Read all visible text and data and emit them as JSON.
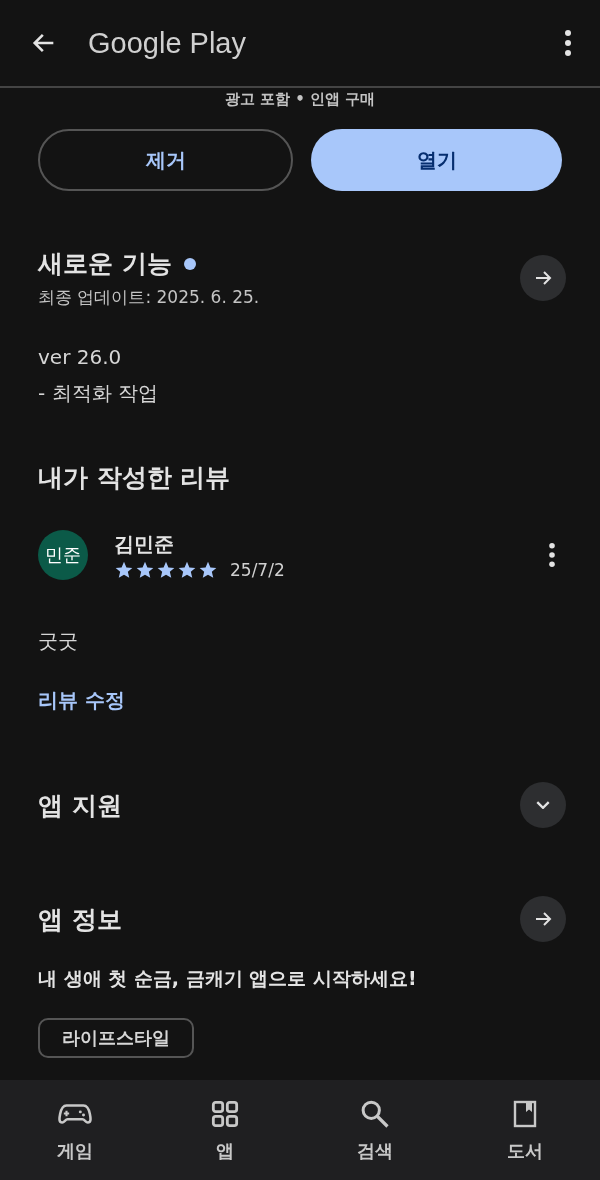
{
  "header": {
    "title": "Google Play"
  },
  "subtitle": "광고 포함 • 인앱 구매",
  "buttons": [
    {
      "label": "제거",
      "kind": "outline"
    },
    {
      "label": "열기",
      "kind": "filled"
    }
  ],
  "whats_new": {
    "title": "새로운 기능",
    "updated": "최종 업데이트: 2025. 6. 25.",
    "lines": [
      "ver 26.0",
      "- 최적화 작업"
    ]
  },
  "my_review": {
    "title": "내가 작성한 리뷰",
    "avatar": "민준",
    "name": "김민준",
    "stars": 5,
    "date": "25/7/2",
    "text": "굿굿",
    "edit_link": "리뷰 수정"
  },
  "sections": [
    {
      "title": "앱 지원",
      "kind": "expand"
    },
    {
      "title": "앱 정보",
      "kind": "arrow"
    }
  ],
  "description": "내 생애 첫 순금, 금캐기 앱으로 시작하세요!",
  "category_chip": "라이프스타일",
  "bottom_nav": [
    {
      "label": "게임",
      "kind": "games",
      "selected": false
    },
    {
      "label": "앱",
      "kind": "apps",
      "selected": false
    },
    {
      "label": "검색",
      "kind": "search",
      "selected": false
    },
    {
      "label": "도서",
      "kind": "books",
      "selected": false
    }
  ]
}
